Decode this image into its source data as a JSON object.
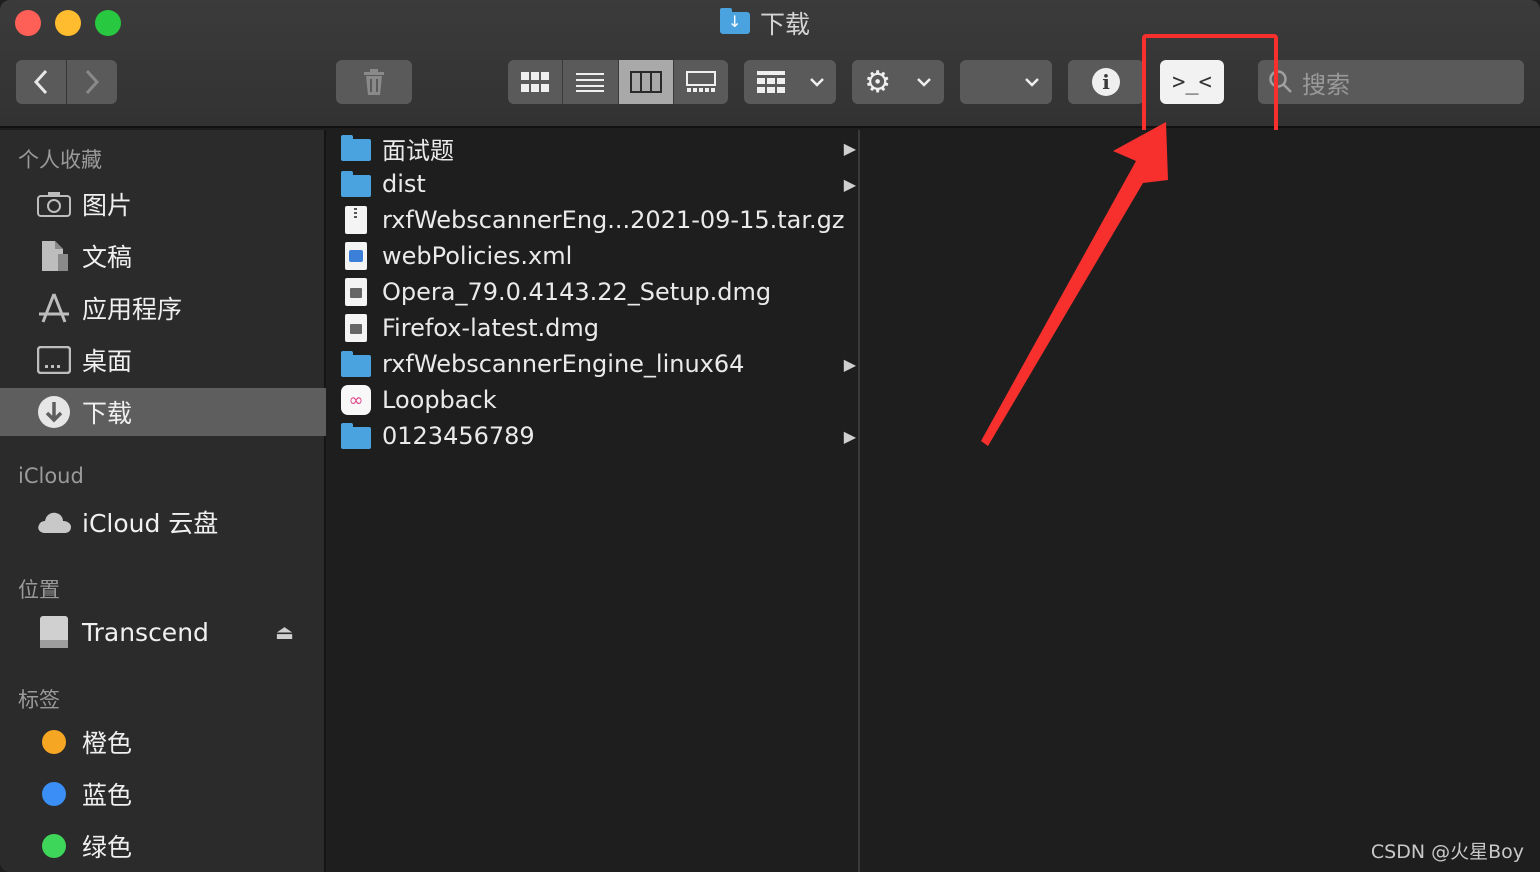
{
  "window": {
    "title": "下载"
  },
  "toolbar": {
    "back_icon": "chevron-left-icon",
    "forward_icon": "chevron-right-icon",
    "trash_icon": "trash-icon",
    "view_modes": [
      {
        "name": "icon-view",
        "glyph": "▦",
        "active": false
      },
      {
        "name": "list-view",
        "glyph": "☰",
        "active": false
      },
      {
        "name": "column-view",
        "glyph": "▥",
        "active": true
      },
      {
        "name": "gallery-view",
        "glyph": "▭",
        "active": false
      }
    ],
    "group_glyph": "▦",
    "gear_glyph": "⚙",
    "chevron_glyph": "⌄",
    "info_glyph": "i",
    "terminal_label": ">_<",
    "search_placeholder": "搜索"
  },
  "sidebar": {
    "sections": [
      {
        "title": "个人收藏"
      },
      {
        "title": "iCloud"
      },
      {
        "title": "位置"
      },
      {
        "title": "标签"
      }
    ],
    "favorites": [
      {
        "label": "图片",
        "icon": "camera-icon",
        "glyph": "📷"
      },
      {
        "label": "文稿",
        "icon": "document-icon",
        "glyph": "🗎"
      },
      {
        "label": "应用程序",
        "icon": "apps-icon",
        "glyph": "⚲"
      },
      {
        "label": "桌面",
        "icon": "desktop-icon",
        "glyph": "▭"
      },
      {
        "label": "下载",
        "icon": "download-icon",
        "glyph": "⬇"
      }
    ],
    "icloud": [
      {
        "label": "iCloud 云盘",
        "icon": "cloud-icon",
        "glyph": "☁"
      }
    ],
    "locations": [
      {
        "label": "Transcend",
        "icon": "drive-icon",
        "glyph": "▬",
        "eject": "⏏"
      }
    ],
    "tags": [
      {
        "label": "橙色",
        "color": "#f5a623"
      },
      {
        "label": "蓝色",
        "color": "#3a8ef6"
      },
      {
        "label": "绿色",
        "color": "#3ed65a"
      }
    ]
  },
  "files": [
    {
      "name": "面试题",
      "kind": "folder",
      "has_children": true
    },
    {
      "name": "dist",
      "kind": "folder",
      "has_children": true
    },
    {
      "name": "rxfWebscannerEng...2021-09-15.tar.gz",
      "kind": "zip",
      "has_children": false
    },
    {
      "name": "webPolicies.xml",
      "kind": "xml",
      "has_children": false
    },
    {
      "name": "Opera_79.0.4143.22_Setup.dmg",
      "kind": "dmg",
      "has_children": false
    },
    {
      "name": "Firefox-latest.dmg",
      "kind": "dmg",
      "has_children": false
    },
    {
      "name": "rxfWebscannerEngine_linux64",
      "kind": "folder",
      "has_children": true
    },
    {
      "name": "Loopback",
      "kind": "app",
      "has_children": false
    },
    {
      "name": "0123456789",
      "kind": "folder",
      "has_children": true
    }
  ],
  "watermark": "CSDN @火星Boy",
  "colors": {
    "annotation": "#f7302d",
    "selected_row": "#5e5e5e"
  }
}
